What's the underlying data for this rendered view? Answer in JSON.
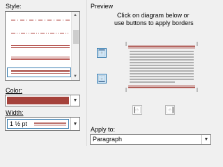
{
  "style_label": "Style:",
  "color_label": "Color:",
  "width_label": "Width:",
  "width_value": "1 ½ pt",
  "preview_label": "Preview",
  "preview_hint": [
    "Click on diagram below or",
    "use buttons to apply borders"
  ],
  "apply_to_label": "Apply to:",
  "apply_to_value": "Paragraph",
  "color_value": "#a5423b",
  "icons": {
    "top_border": "top-border-icon",
    "bottom_border": "bottom-border-icon",
    "left_border": "left-border-icon",
    "right_border": "right-border-icon"
  }
}
